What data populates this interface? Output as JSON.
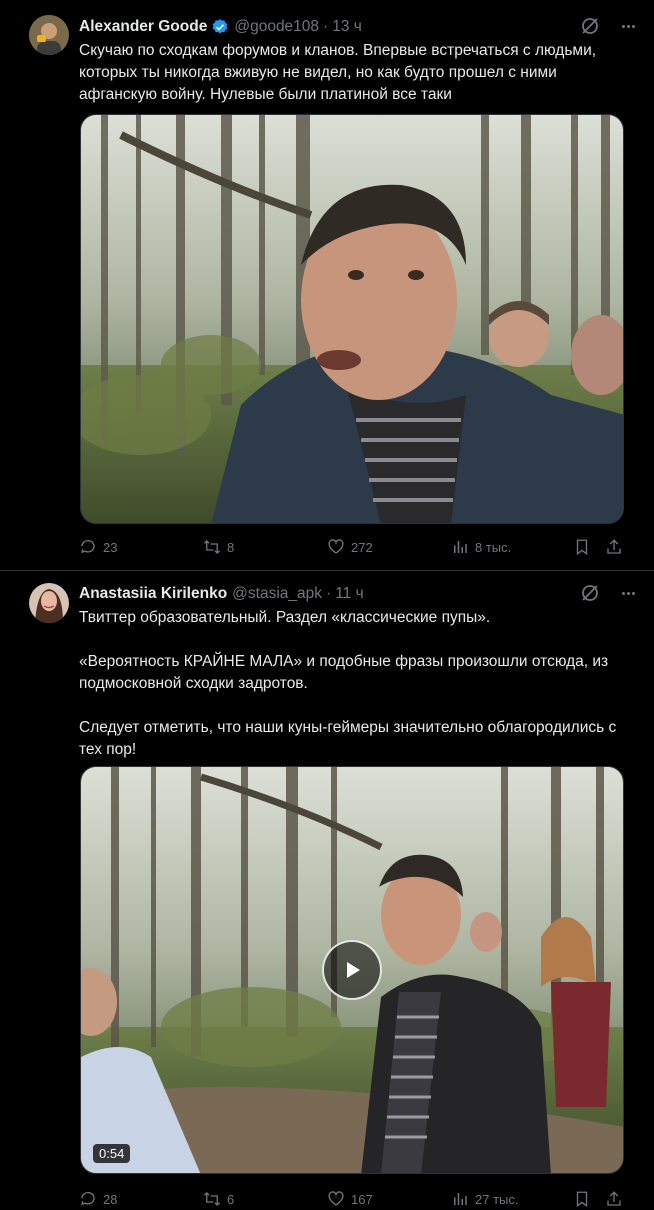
{
  "tweets": [
    {
      "author_name": "Alexander Goode",
      "handle": "@goode108",
      "separator": "·",
      "time": "13 ч",
      "verified": true,
      "text": "Скучаю по сходкам форумов и кланов. Впервые встречаться с людьми, которых ты никогда вживую не видел, но как будто прошел с ними афганскую войну. Нулевые были платиной все таки",
      "media_type": "image",
      "actions": {
        "replies": "23",
        "reposts": "8",
        "likes": "272",
        "views": "8 тыс."
      }
    },
    {
      "author_name": "Anastasiia Kirilenko",
      "handle": "@stasia_apk",
      "separator": "·",
      "time": "11 ч",
      "verified": false,
      "text": "Твиттер образовательный. Раздел «классические пупы».\n\n«Вероятность КРАЙНЕ МАЛА» и подобные фразы произошли отсюда, из подмосковной сходки задротов.\n\nСледует отметить, что наши куны-геймеры значительно облагородились с тех пор!",
      "media_type": "video",
      "video_duration": "0:54",
      "actions": {
        "replies": "28",
        "reposts": "6",
        "likes": "167",
        "views": "27 тыс."
      }
    }
  ],
  "colors": {
    "background": "#000000",
    "text": "#e7e9ea",
    "muted": "#71767b",
    "verified": "#1d9bf0",
    "divider": "#2f3336"
  }
}
